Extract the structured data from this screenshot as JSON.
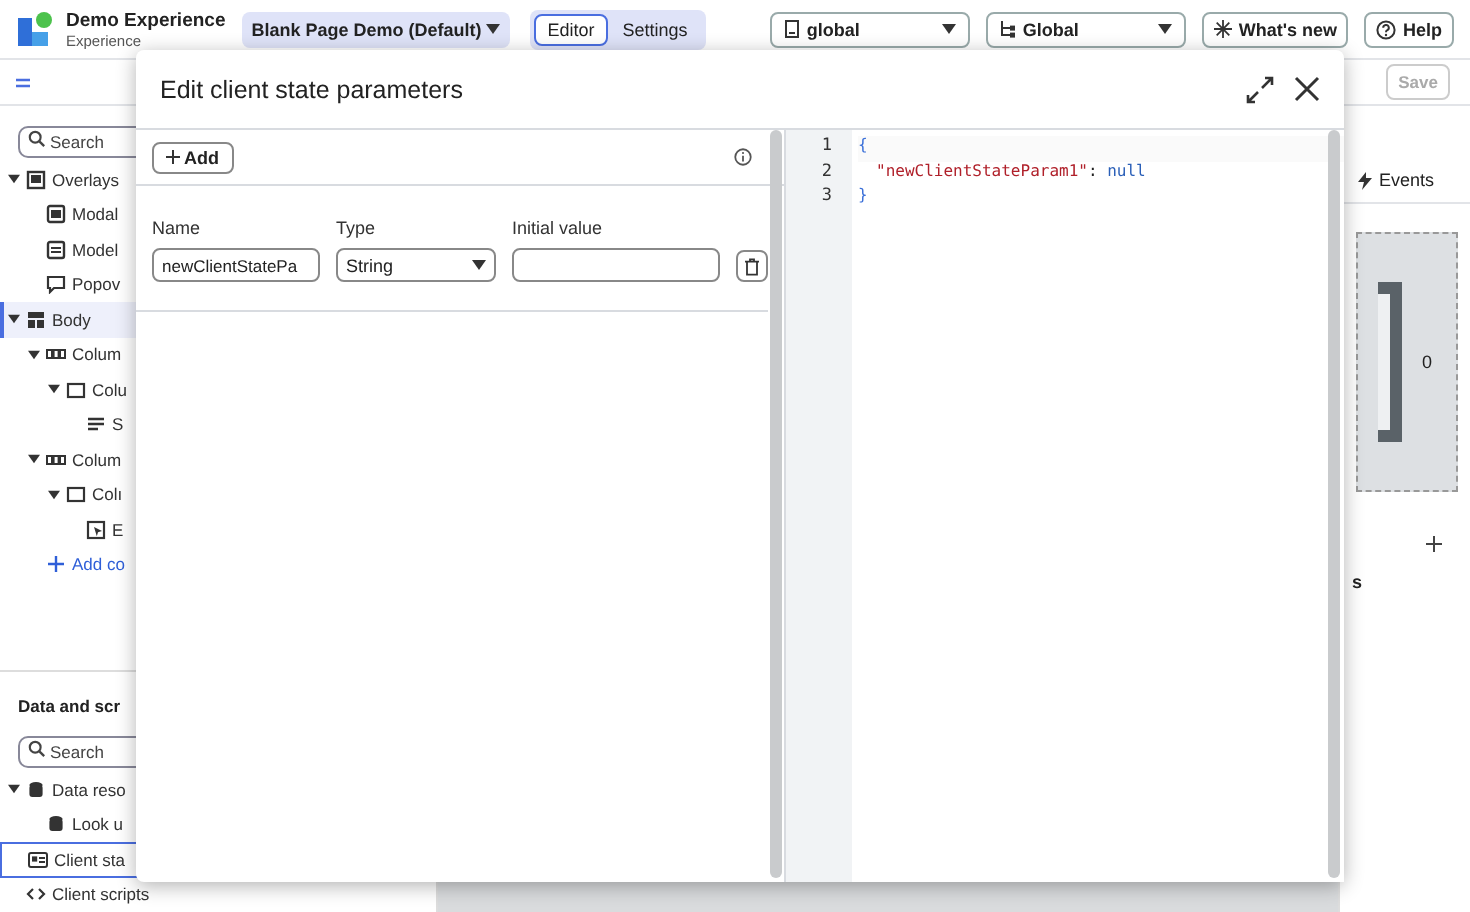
{
  "header": {
    "app_title": "Demo Experience",
    "app_subtitle": "Experience",
    "page_selector": "Blank Page Demo (Default)",
    "mode_tabs": [
      {
        "label": "Editor",
        "selected": true
      },
      {
        "label": "Settings",
        "selected": false
      }
    ],
    "scope_dropdowns": [
      {
        "label": "global",
        "kind": "scope"
      },
      {
        "label": "Global",
        "kind": "tree"
      }
    ],
    "buttons": [
      {
        "label": "What's new",
        "kind": "whatsnew"
      },
      {
        "label": "Help",
        "kind": "help"
      }
    ]
  },
  "sidebar": {
    "search": {
      "placeholder": "Search"
    },
    "tree": [
      {
        "label": "Overlays",
        "kind": "overlay",
        "expanded": true,
        "selected": false,
        "children": [
          {
            "label": "Modal",
            "kind": "modal",
            "selected": false
          },
          {
            "label": "Model",
            "kind": "model",
            "selected": false
          },
          {
            "label": "Popov",
            "kind": "popover",
            "selected": false
          }
        ]
      },
      {
        "label": "Body",
        "kind": "body",
        "expanded": true,
        "selected": true,
        "children": [
          {
            "label": "Colum",
            "kind": "columns",
            "expanded": true,
            "selected": false,
            "children": [
              {
                "label": "Colu",
                "kind": "column",
                "expanded": true,
                "selected": false,
                "children": [
                  {
                    "label": "S",
                    "kind": "text",
                    "selected": false
                  }
                ]
              }
            ]
          },
          {
            "label": "Colum",
            "kind": "columns",
            "expanded": true,
            "selected": false,
            "children": [
              {
                "label": "Colı",
                "kind": "column",
                "expanded": true,
                "selected": false,
                "children": [
                  {
                    "label": "E",
                    "kind": "button",
                    "selected": false
                  }
                ]
              }
            ]
          },
          {
            "label": "Add co",
            "kind": "add",
            "selected": false
          }
        ]
      }
    ],
    "data_section": {
      "title": "Data and scr",
      "search": {
        "placeholder": "Search"
      },
      "tree": [
        {
          "label": "Data reso",
          "kind": "database",
          "expanded": true,
          "selected": false,
          "children": [
            {
              "label": "Look u",
              "kind": "database",
              "selected": false
            }
          ]
        },
        {
          "label": "Client sta",
          "kind": "state",
          "selected": true
        },
        {
          "label": "Client scripts",
          "kind": "script",
          "selected": false
        }
      ]
    }
  },
  "right_panel": {
    "save_button": {
      "label": "Save",
      "disabled": true
    },
    "tab": "Events",
    "canvas_value": "0",
    "text_1": "s"
  },
  "modal": {
    "title": "Edit client state parameters",
    "add_button": "Add",
    "columns": [
      "Name",
      "Type",
      "Initial value"
    ],
    "parameters": [
      {
        "name": "newClientStatePa",
        "type": "String"
      }
    ],
    "editor_lines": [
      {
        "number": "1",
        "indented": false,
        "tokens": [
          {
            "kind": "brace",
            "text": "{"
          }
        ]
      },
      {
        "number": "2",
        "indented": true,
        "tokens": [
          {
            "kind": "key",
            "text": "\"newClientStateParam1\""
          },
          {
            "kind": "punct",
            "text": ": "
          },
          {
            "kind": "literal",
            "text": "null"
          }
        ]
      },
      {
        "number": "3",
        "indented": false,
        "tokens": [
          {
            "kind": "brace",
            "text": "}"
          }
        ]
      }
    ]
  }
}
